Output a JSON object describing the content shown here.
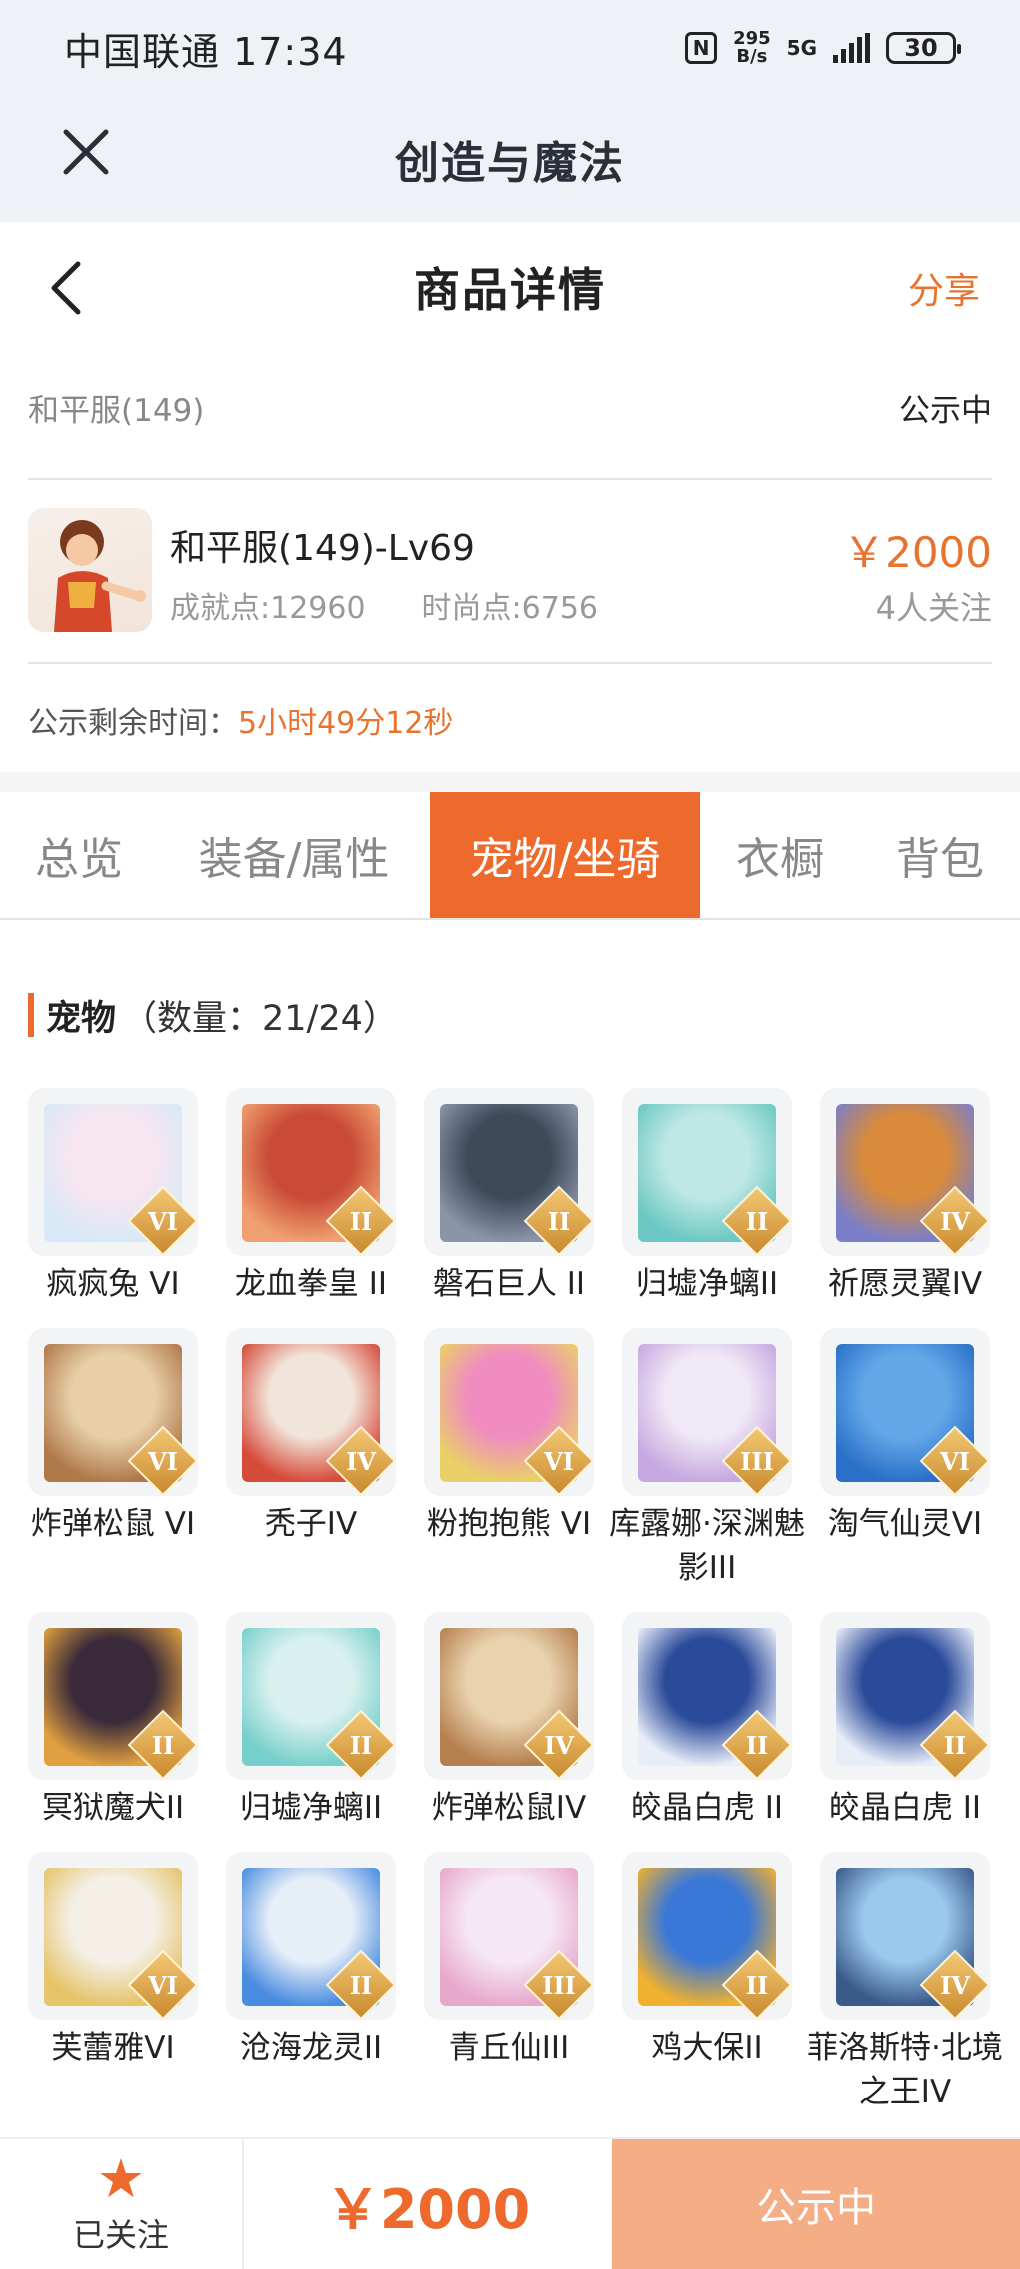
{
  "status_bar": {
    "carrier_time": "中国联通 17:34",
    "nfc": "N",
    "net_speed_value": "295",
    "net_speed_unit": "B/s",
    "network": "5G",
    "battery": "30"
  },
  "app_bar": {
    "title": "创造与魔法",
    "close_icon": "close-icon"
  },
  "page_header": {
    "title": "商品详情",
    "share_label": "分享",
    "back_icon": "chevron-left-icon"
  },
  "listing": {
    "server": "和平服(149)",
    "status": "公示中",
    "character_name": "和平服(149)-Lv69",
    "achievement": "成就点:12960",
    "fashion": "时尚点:6756",
    "price": "￥2000",
    "followers": "4人关注",
    "remaining_label": "公示剩余时间：",
    "remaining_value": "5小时49分12秒"
  },
  "tabs": [
    {
      "label": "总览",
      "active": false
    },
    {
      "label": "装备/属性",
      "active": false
    },
    {
      "label": "宠物/坐骑",
      "active": true
    },
    {
      "label": "衣橱",
      "active": false
    },
    {
      "label": "背包",
      "active": false
    }
  ],
  "pets_section": {
    "title": "宠物",
    "count": "（数量：21/24）",
    "pets": [
      {
        "name": "疯疯兔 VI",
        "tier": "VI",
        "color_a": "#f7e6ef",
        "color_b": "#d9e8f7"
      },
      {
        "name": "龙血拳皇 II",
        "tier": "II",
        "color_a": "#c94a36",
        "color_b": "#f0a070"
      },
      {
        "name": "磐石巨人 II",
        "tier": "II",
        "color_a": "#3e4a5a",
        "color_b": "#8a96a8"
      },
      {
        "name": "归墟净螭II",
        "tier": "II",
        "color_a": "#bfe8e4",
        "color_b": "#6cc8c4"
      },
      {
        "name": "祈愿灵翼IV",
        "tier": "IV",
        "color_a": "#d98a3a",
        "color_b": "#7b7fc8"
      },
      {
        "name": "炸弹松鼠 VI",
        "tier": "VI",
        "color_a": "#e8cfa8",
        "color_b": "#b0794a"
      },
      {
        "name": "秃子IV",
        "tier": "IV",
        "color_a": "#f1e4d8",
        "color_b": "#d64a3a"
      },
      {
        "name": "粉抱抱熊 VI",
        "tier": "VI",
        "color_a": "#f08cc0",
        "color_b": "#e9d068"
      },
      {
        "name": "库露娜·深渊魅影III",
        "tier": "III",
        "color_a": "#efe8f6",
        "color_b": "#c8a8e0"
      },
      {
        "name": "淘气仙灵VI",
        "tier": "VI",
        "color_a": "#62a8e8",
        "color_b": "#2a70c8"
      },
      {
        "name": "冥狱魔犬II",
        "tier": "II",
        "color_a": "#3a2a3a",
        "color_b": "#e0a040"
      },
      {
        "name": "归墟净螭II",
        "tier": "II",
        "color_a": "#d8f0ee",
        "color_b": "#78d0cc"
      },
      {
        "name": "炸弹松鼠IV",
        "tier": "IV",
        "color_a": "#ead2ae",
        "color_b": "#b5804e"
      },
      {
        "name": "皎晶白虎 II",
        "tier": "II",
        "color_a": "#2a4a9a",
        "color_b": "#e8eef8"
      },
      {
        "name": "皎晶白虎 II",
        "tier": "II",
        "color_a": "#2a4a9a",
        "color_b": "#e8eef8"
      },
      {
        "name": "芙蕾雅VI",
        "tier": "VI",
        "color_a": "#f4f0e8",
        "color_b": "#e6c46a"
      },
      {
        "name": "沧海龙灵II",
        "tier": "II",
        "color_a": "#e6eef8",
        "color_b": "#4a8ce0"
      },
      {
        "name": "青丘仙III",
        "tier": "III",
        "color_a": "#f6e8f2",
        "color_b": "#e8a8cc"
      },
      {
        "name": "鸡大保II",
        "tier": "II",
        "color_a": "#3a78d8",
        "color_b": "#f0b030"
      },
      {
        "name": "菲洛斯特·北境之王IV",
        "tier": "IV",
        "color_a": "#9ac8ee",
        "color_b": "#3a5a8a"
      }
    ]
  },
  "bottom_bar": {
    "follow_label": "已关注",
    "follow_icon": "star-icon",
    "price": "￥2000",
    "action_label": "公示中"
  },
  "colors": {
    "accent": "#ee6a2c",
    "action_bg": "#f4ad84",
    "header_bg": "#eef2f6"
  }
}
